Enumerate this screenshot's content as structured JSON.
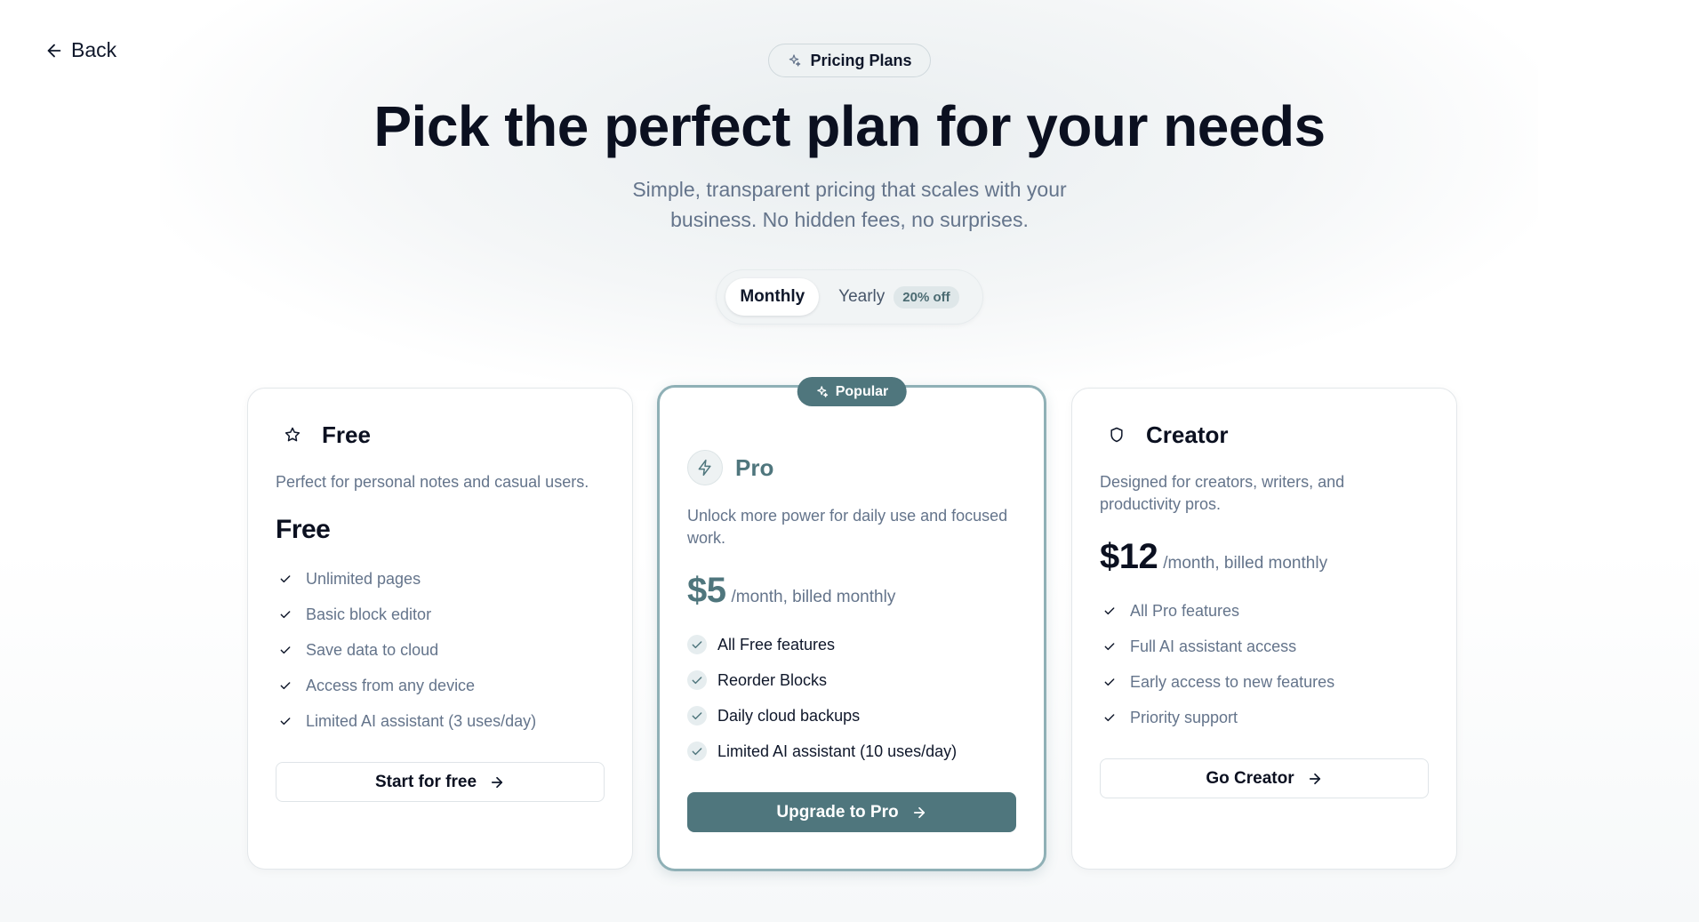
{
  "nav": {
    "back_label": "Back"
  },
  "hero": {
    "pill_label": "Pricing Plans",
    "title": "Pick the perfect plan for your needs",
    "subtitle": "Simple, transparent pricing that scales with your business. No hidden fees, no surprises."
  },
  "billing_toggle": {
    "options": [
      {
        "label": "Monthly",
        "active": true
      },
      {
        "label": "Yearly",
        "active": false
      }
    ],
    "yearly_badge": "20% off"
  },
  "colors": {
    "accent": "#4f767d",
    "accent_border": "#8fb0b6",
    "text_dark": "#0b1020",
    "text_muted": "#64748b"
  },
  "plans": [
    {
      "name": "Free",
      "icon": "star-icon",
      "description": "Perfect for personal notes and casual users.",
      "price": "Free",
      "period": "",
      "features": [
        "Unlimited pages",
        "Basic block editor",
        "Save data to cloud",
        "Access from any device",
        "Limited AI assistant (3 uses/day)"
      ],
      "cta": "Start for free"
    },
    {
      "name": "Pro",
      "icon": "lightning-icon",
      "badge": "Popular",
      "description": "Unlock more power for daily use and focused work.",
      "price": "$5",
      "period": "/month, billed monthly",
      "features": [
        "All Free features",
        "Reorder Blocks",
        "Daily cloud backups",
        "Limited AI assistant (10 uses/day)"
      ],
      "cta": "Upgrade to Pro"
    },
    {
      "name": "Creator",
      "icon": "shield-icon",
      "description": "Designed for creators, writers, and productivity pros.",
      "price": "$12",
      "period": "/month, billed monthly",
      "features": [
        "All Pro features",
        "Full AI assistant access",
        "Early access to new features",
        "Priority support"
      ],
      "cta": "Go Creator"
    }
  ]
}
